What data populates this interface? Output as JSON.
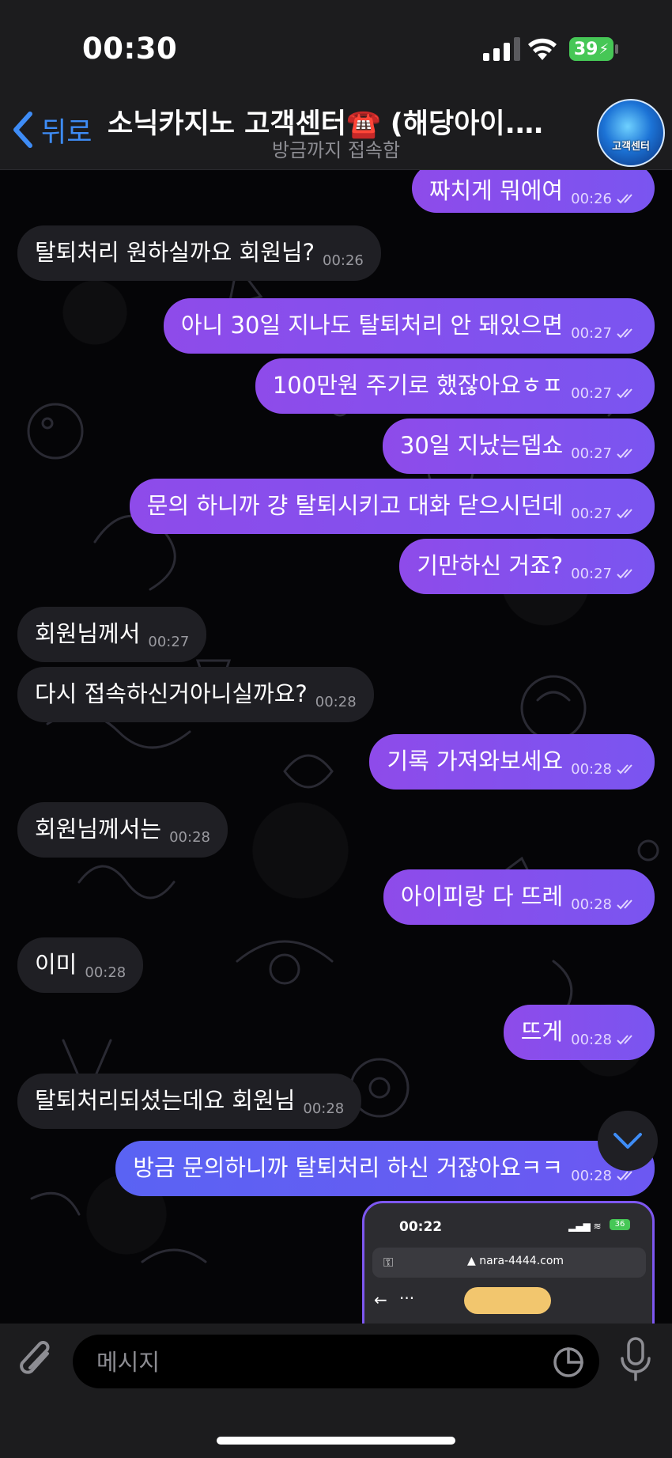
{
  "status": {
    "time": "00:30",
    "battery": "39"
  },
  "header": {
    "back_label": "뒤로",
    "title": "소닉카지노 고객센터☎️ (해당아이... 🦔",
    "subtitle": "방금까지 접속함",
    "avatar_text": "고객센터"
  },
  "messages": [
    {
      "dir": "out",
      "text": "짜치게 뭐에여",
      "time": "00:26"
    },
    {
      "dir": "in",
      "text": "탈퇴처리 원하실까요 회원님?",
      "time": "00:26"
    },
    {
      "dir": "out",
      "text": "아니 30일 지나도 탈퇴처리 안 돼있으면",
      "time": "00:27"
    },
    {
      "dir": "out",
      "text": "100만원 주기로 했잖아요ㅎㅍ",
      "time": "00:27"
    },
    {
      "dir": "out",
      "text": "30일 지났는뎁쇼",
      "time": "00:27"
    },
    {
      "dir": "out",
      "text": "문의 하니까 걍 탈퇴시키고 대화 닫으시던데",
      "time": "00:27"
    },
    {
      "dir": "out",
      "text": "기만하신 거죠?",
      "time": "00:27"
    },
    {
      "dir": "in",
      "text": "회원님께서",
      "time": "00:27"
    },
    {
      "dir": "in",
      "text": "다시 접속하신거아니실까요?",
      "time": "00:28"
    },
    {
      "dir": "out",
      "text": "기록 가져와보세요",
      "time": "00:28"
    },
    {
      "dir": "in",
      "text": "회원님께서는",
      "time": "00:28"
    },
    {
      "dir": "out",
      "text": "아이피랑 다 뜨레",
      "time": "00:28"
    },
    {
      "dir": "in",
      "text": "이미",
      "time": "00:28"
    },
    {
      "dir": "out",
      "text": "뜨게",
      "time": "00:28"
    },
    {
      "dir": "in",
      "text": "탈퇴처리되셨는데요 회원님",
      "time": "00:28"
    },
    {
      "dir": "out",
      "text": "방금 문의하니까 탈퇴처리 하신 거잖아요ㅋㅋ",
      "time": "00:28"
    }
  ],
  "screenshot": {
    "time": "00:22",
    "url": "nara-4444.com",
    "battery": "36"
  },
  "input": {
    "placeholder": "메시지"
  },
  "colors": {
    "accent": "#3e8cf6",
    "outgoing": "#8e4bea",
    "incoming": "#1f1f24"
  }
}
